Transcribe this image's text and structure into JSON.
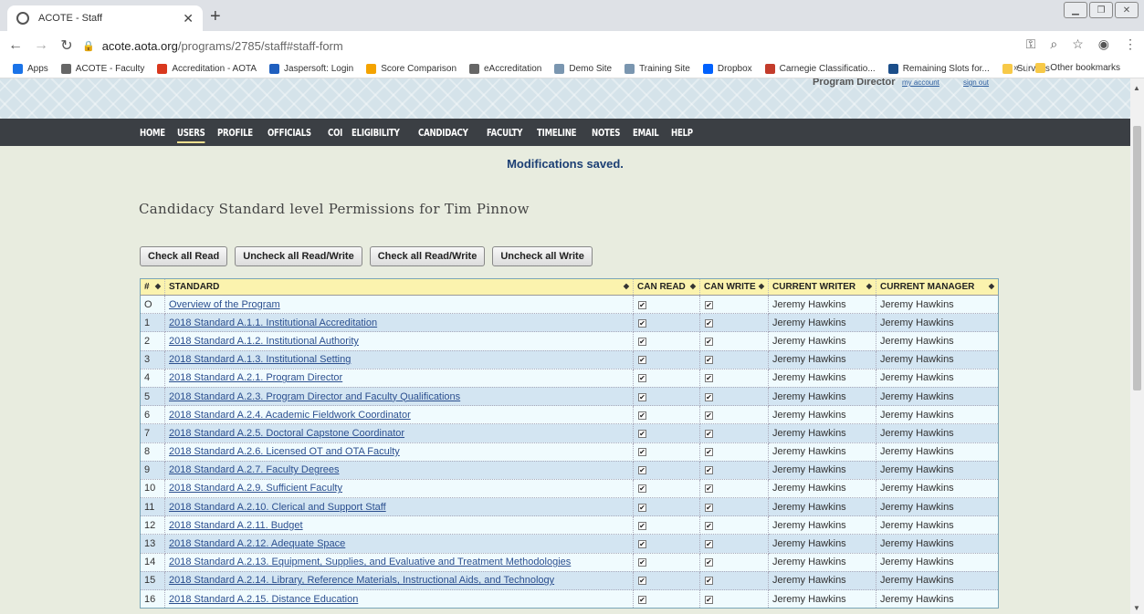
{
  "browser": {
    "tab_title": "ACOTE - Staff",
    "url_host": "acote.aota.org",
    "url_path": "/programs/2785/staff#staff-form",
    "bookmarks": [
      {
        "label": "Apps",
        "color": "#1a73e8"
      },
      {
        "label": "ACOTE - Faculty",
        "color": "#666666"
      },
      {
        "label": "Accreditation - AOTA",
        "color": "#d9381e"
      },
      {
        "label": "Jaspersoft: Login",
        "color": "#1f5fbf"
      },
      {
        "label": "Score Comparison",
        "color": "#f4a300"
      },
      {
        "label": "eAccreditation",
        "color": "#666666"
      },
      {
        "label": "Demo Site",
        "color": "#7a96b0"
      },
      {
        "label": "Training Site",
        "color": "#7a96b0"
      },
      {
        "label": "Dropbox",
        "color": "#0061fe"
      },
      {
        "label": "Carnegie Classificatio...",
        "color": "#c33c2b"
      },
      {
        "label": "Remaining Slots for...",
        "color": "#1b4e8a"
      },
      {
        "label": "Surveys",
        "color": "#f7c948"
      }
    ],
    "bookmarks_more": "»",
    "other_bookmarks": "Other bookmarks"
  },
  "banner": {
    "role": "Program Director",
    "my_account": "my account",
    "sign_out": "sign out"
  },
  "nav": {
    "items": [
      "HOME",
      "USERS",
      "PROFILE",
      "OFFICIALS",
      "COI",
      "ELIGIBILITY",
      "CANDIDACY",
      "FACULTY",
      "TIMELINE",
      "NOTES",
      "EMAIL",
      "HELP"
    ],
    "active": "USERS"
  },
  "message": "Modifications saved.",
  "heading": "Candidacy Standard level Permissions for Tim Pinnow",
  "buttons": {
    "check_all_read": "Check all Read",
    "uncheck_all_read_write": "Uncheck all Read/Write",
    "check_all_read_write": "Check all Read/Write",
    "uncheck_all_write": "Uncheck all Write"
  },
  "table": {
    "headers": {
      "num": "#",
      "standard": "STANDARD",
      "can_read": "CAN READ",
      "can_write": "CAN WRITE",
      "current_writer": "CURRENT WRITER",
      "current_manager": "CURRENT MANAGER"
    },
    "checkmark": "✔",
    "rows": [
      {
        "num": "O",
        "standard": "Overview of the Program",
        "writer": "Jeremy Hawkins",
        "manager": "Jeremy Hawkins"
      },
      {
        "num": "1",
        "standard": "2018 Standard A.1.1. Institutional Accreditation",
        "writer": "Jeremy Hawkins",
        "manager": "Jeremy Hawkins"
      },
      {
        "num": "2",
        "standard": "2018 Standard A.1.2. Institutional Authority",
        "writer": "Jeremy Hawkins",
        "manager": "Jeremy Hawkins"
      },
      {
        "num": "3",
        "standard": "2018 Standard A.1.3. Institutional Setting",
        "writer": "Jeremy Hawkins",
        "manager": "Jeremy Hawkins"
      },
      {
        "num": "4",
        "standard": "2018 Standard A.2.1. Program Director",
        "writer": "Jeremy Hawkins",
        "manager": "Jeremy Hawkins"
      },
      {
        "num": "5",
        "standard": "2018 Standard A.2.3. Program Director and Faculty Qualifications",
        "writer": "Jeremy Hawkins",
        "manager": "Jeremy Hawkins"
      },
      {
        "num": "6",
        "standard": "2018 Standard A.2.4. Academic Fieldwork Coordinator",
        "writer": "Jeremy Hawkins",
        "manager": "Jeremy Hawkins"
      },
      {
        "num": "7",
        "standard": "2018 Standard A.2.5. Doctoral Capstone Coordinator",
        "writer": "Jeremy Hawkins",
        "manager": "Jeremy Hawkins"
      },
      {
        "num": "8",
        "standard": "2018 Standard A.2.6. Licensed OT and OTA Faculty",
        "writer": "Jeremy Hawkins",
        "manager": "Jeremy Hawkins"
      },
      {
        "num": "9",
        "standard": "2018 Standard A.2.7. Faculty Degrees",
        "writer": "Jeremy Hawkins",
        "manager": "Jeremy Hawkins"
      },
      {
        "num": "10",
        "standard": "2018 Standard A.2.9. Sufficient Faculty",
        "writer": "Jeremy Hawkins",
        "manager": "Jeremy Hawkins"
      },
      {
        "num": "11",
        "standard": "2018 Standard A.2.10. Clerical and Support Staff",
        "writer": "Jeremy Hawkins",
        "manager": "Jeremy Hawkins"
      },
      {
        "num": "12",
        "standard": "2018 Standard A.2.11. Budget",
        "writer": "Jeremy Hawkins",
        "manager": "Jeremy Hawkins"
      },
      {
        "num": "13",
        "standard": "2018 Standard A.2.12. Adequate Space",
        "writer": "Jeremy Hawkins",
        "manager": "Jeremy Hawkins"
      },
      {
        "num": "14",
        "standard": "2018 Standard A.2.13. Equipment, Supplies, and Evaluative and Treatment Methodologies",
        "writer": "Jeremy Hawkins",
        "manager": "Jeremy Hawkins"
      },
      {
        "num": "15",
        "standard": "2018 Standard A.2.14. Library, Reference Materials, Instructional Aids, and Technology",
        "writer": "Jeremy Hawkins",
        "manager": "Jeremy Hawkins"
      },
      {
        "num": "16",
        "standard": "2018 Standard A.2.15. Distance Education",
        "writer": "Jeremy Hawkins",
        "manager": "Jeremy Hawkins"
      }
    ]
  },
  "colors": {
    "nav_bg": "#3b3f44",
    "header_bg": "#fbf3ae",
    "row_odd": "#f0fbfe",
    "row_even": "#d3e5f2",
    "message": "#1c3f74",
    "page_bg": "#e8ecdf"
  }
}
